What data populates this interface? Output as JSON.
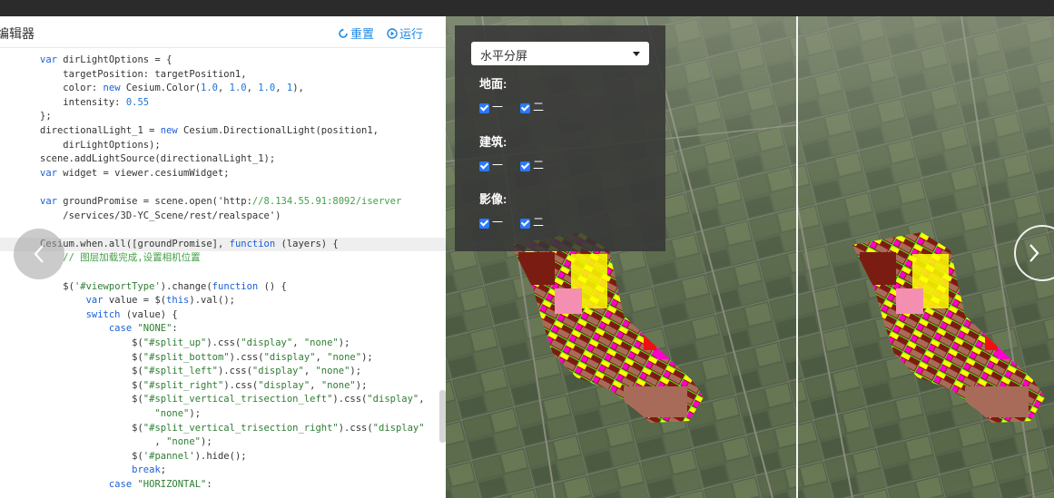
{
  "editor": {
    "title": "编辑器",
    "reset_label": "重置",
    "run_label": "运行",
    "code_lines": [
      "var dirLightOptions = {",
      "    targetPosition: targetPosition1,",
      "    color: new Cesium.Color(1.0, 1.0, 1.0, 1),",
      "    intensity: 0.55",
      "};",
      "directionalLight_1 = new Cesium.DirectionalLight(position1,",
      "    dirLightOptions);",
      "scene.addLightSource(directionalLight_1);",
      "var widget = viewer.cesiumWidget;",
      "",
      "var groundPromise = scene.open('http://8.134.55.91:8092/iserver",
      "    /services/3D-YC_Scene/rest/realspace')",
      "",
      "Cesium.when.all([groundPromise], function (layers) {",
      "    // 图层加载完成,设置相机位置",
      "",
      "    $('#viewportType').change(function () {",
      "        var value = $(this).val();",
      "        switch (value) {",
      "            case \"NONE\":",
      "                $(\"#split_up\").css(\"display\", \"none\");",
      "                $(\"#split_bottom\").css(\"display\", \"none\");",
      "                $(\"#split_left\").css(\"display\", \"none\");",
      "                $(\"#split_right\").css(\"display\", \"none\");",
      "                $(\"#split_vertical_trisection_left\").css(\"display\",",
      "                    \"none\");",
      "                $(\"#split_vertical_trisection_right\").css(\"display\"",
      "                    , \"none\");",
      "                $('#pannel').hide();",
      "                break;",
      "            case \"HORIZONTAL\":"
    ]
  },
  "panel": {
    "viewport_select": "水平分屏",
    "groups": [
      {
        "label": "地面:",
        "options": [
          "一",
          "二"
        ]
      },
      {
        "label": "建筑:",
        "options": [
          "一",
          "二"
        ]
      },
      {
        "label": "影像:",
        "options": [
          "一",
          "二"
        ]
      }
    ]
  },
  "colors": {
    "accent": "#1e88e5",
    "checkbox": "#2979ff",
    "parcel_residential": "#ffff00",
    "parcel_industrial": "#7b1c12",
    "parcel_commercial": "#ff00cc",
    "parcel_green": "#44ee22",
    "parcel_public": "#f48fb1",
    "parcel_red": "#ee1111",
    "parcel_brown": "#a86b5a"
  }
}
